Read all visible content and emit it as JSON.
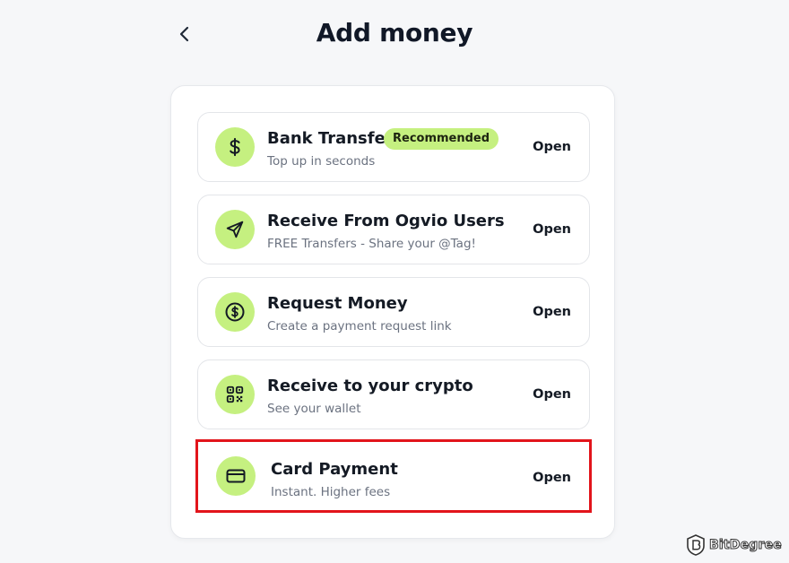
{
  "header": {
    "title": "Add money",
    "back_icon": "chevron-left-icon"
  },
  "colors": {
    "accent": "#c5f080",
    "highlight_border": "#e2141b",
    "background": "#f6f7f9"
  },
  "options": [
    {
      "title": "Bank Transfer",
      "badge": "Recommended",
      "subtitle": "Top up in seconds",
      "action": "Open",
      "icon": "dollar-icon"
    },
    {
      "title": "Receive From Ogvio Users",
      "subtitle": "FREE Transfers - Share your @Tag!",
      "action": "Open",
      "icon": "send-icon"
    },
    {
      "title": "Request Money",
      "subtitle": "Create a payment request link",
      "action": "Open",
      "icon": "dollar-circle-icon"
    },
    {
      "title": "Receive to your crypto",
      "subtitle": "See your wallet",
      "action": "Open",
      "icon": "qr-code-icon"
    },
    {
      "title": "Card Payment",
      "subtitle": "Instant. Higher fees",
      "action": "Open",
      "icon": "credit-card-icon",
      "highlighted": true
    }
  ],
  "watermark": {
    "text": "BitDegree",
    "icon": "bitdegree-logo-icon"
  }
}
